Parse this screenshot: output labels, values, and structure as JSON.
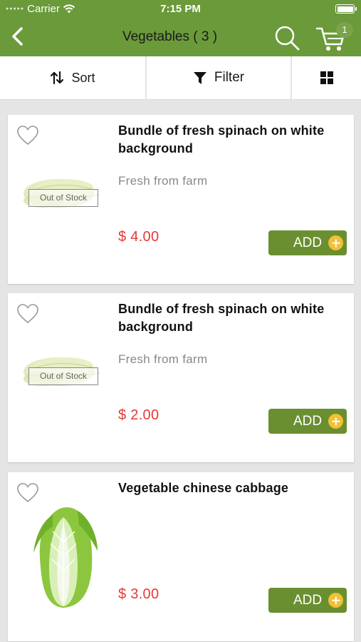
{
  "status_bar": {
    "carrier": "Carrier",
    "time": "7:15 PM"
  },
  "header": {
    "title": "Vegetables ( 3 )",
    "cart_count": "1",
    "brand_color": "#6a9a3a"
  },
  "toolbar": {
    "sort_label": "Sort",
    "filter_label": "Filter"
  },
  "products": [
    {
      "name": "Bundle of fresh spinach on white background",
      "description": "Fresh from farm",
      "price": "$ 4.00",
      "stock_label": "Out of Stock",
      "add_label": "ADD"
    },
    {
      "name": "Bundle of fresh spinach on white background",
      "description": "Fresh from farm",
      "price": "$ 2.00",
      "stock_label": "Out of Stock",
      "add_label": "ADD"
    },
    {
      "name": "Vegetable chinese cabbage",
      "description": "",
      "price": "$ 3.00",
      "add_label": "ADD"
    }
  ],
  "colors": {
    "price": "#e53935",
    "add_button": "#6a8f30",
    "add_icon": "#f2c034"
  }
}
